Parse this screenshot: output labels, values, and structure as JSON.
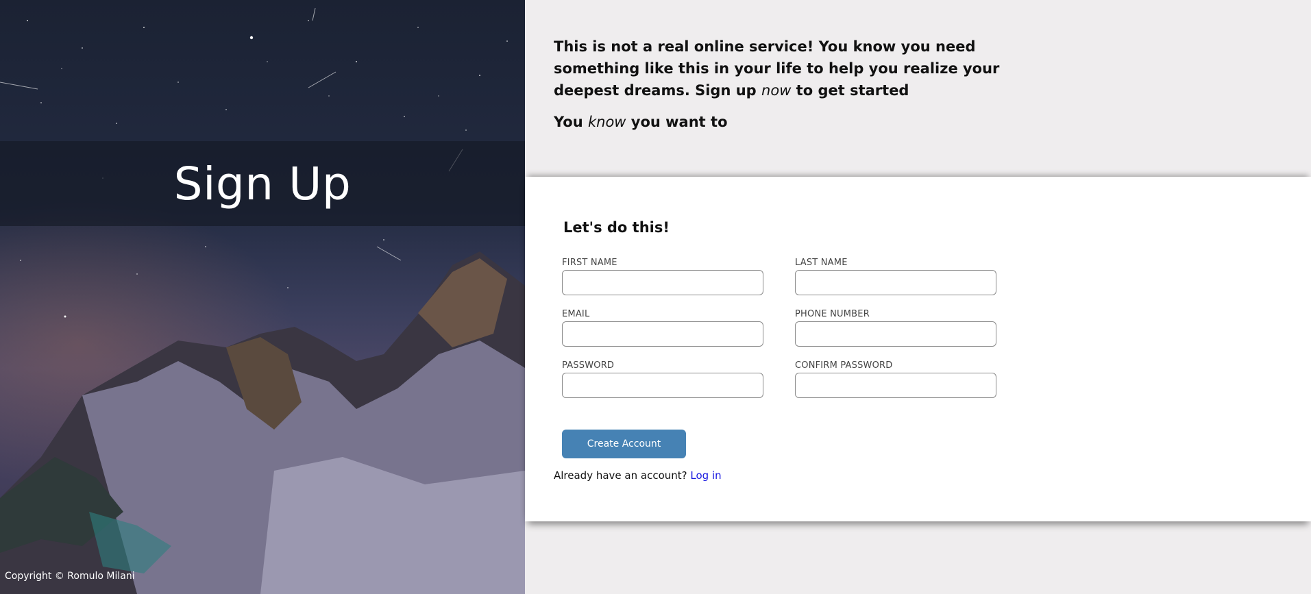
{
  "hero": {
    "title": "Sign Up",
    "copyright": "Copyright © Romulo Milani"
  },
  "intro": {
    "paragraph1_part1": "This is not a real online service! You know you need something like this in your life to help you realize your deepest dreams. Sign up ",
    "paragraph1_emphasis": "now",
    "paragraph1_part2": " to get started",
    "paragraph2_part1": "You ",
    "paragraph2_emphasis": "know",
    "paragraph2_part2": " you want to"
  },
  "form": {
    "heading": "Let's do this!",
    "fields": {
      "first_name": {
        "label": "FIRST NAME",
        "value": ""
      },
      "last_name": {
        "label": "LAST NAME",
        "value": ""
      },
      "email": {
        "label": "EMAIL",
        "value": ""
      },
      "phone": {
        "label": "PHONE NUMBER",
        "value": ""
      },
      "password": {
        "label": "PASSWORD",
        "value": ""
      },
      "confirm_password": {
        "label": "CONFIRM PASSWORD",
        "value": ""
      }
    },
    "submit_label": "Create Account",
    "login_prompt": "Already have an account?",
    "login_link": "Log in"
  },
  "colors": {
    "accent": "#4682b4",
    "link": "#1a1ae0",
    "background": "#efedee",
    "card": "#ffffff"
  },
  "icons": []
}
